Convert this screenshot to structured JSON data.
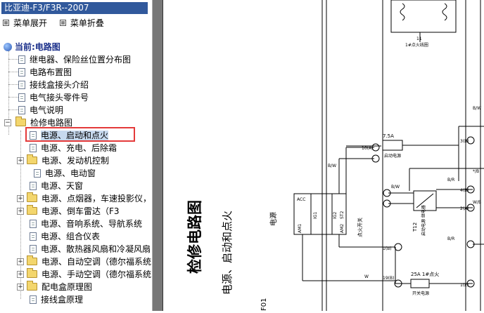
{
  "window": {
    "title": "比亚迪-F3/F3R--2007"
  },
  "menu": {
    "expand": "菜单展开",
    "collapse": "菜单折叠"
  },
  "tree": {
    "current": "当前:电路图",
    "items": [
      "继电器、保险丝位置分布图",
      "电路布置图",
      "接线盒接头介绍",
      "电气接头零件号",
      "电气说明",
      "检修电路图",
      "电源、启动和点火",
      "电源、充电、后除霜",
      "电源、发动机控制",
      "电源、电动窗",
      "电源、天窗",
      "电源、点烟器，车速投影仪，",
      "电源、倒车雷达（F3",
      "电源、音响系统、导航系统",
      "电源、组合仪表",
      "电源、散热器风扇和冷凝风扇",
      "电源、自动空调（德尔福系统",
      "电源、手动空调（德尔福系统",
      "配电盒原理图",
      "接线盒原理"
    ]
  },
  "diagram": {
    "vertical_title": "检修电路图",
    "vertical_subtitle": "电源、启动和点火",
    "label_power": "电源",
    "label_f01": "F01",
    "fuse_1": "7.5A",
    "fuse_1_name": "启动电源",
    "fuse_2": "25A  1#点火",
    "fuse_2_name": "开关电源",
    "relay_name": "T12",
    "relay_sub": "启动电源 继电器",
    "switch_name": "点火开关",
    "top_label": "1#点火线圈",
    "top_num": "11",
    "pins": [
      "ACC",
      "IG1",
      "IG2",
      "ST2",
      "AM1",
      "AM2",
      "B/W",
      "R",
      "B/R",
      "W",
      "*/B"
    ],
    "wire_labels": [
      "B/W",
      "B/R",
      "B/R",
      "W",
      "B/W",
      "*/B",
      "B/W",
      "W/B"
    ],
    "connectors": [
      "10(A)",
      "3(B)",
      "4(B)",
      "2(A)",
      "1(B)",
      "19(B)",
      "1(E)"
    ]
  }
}
